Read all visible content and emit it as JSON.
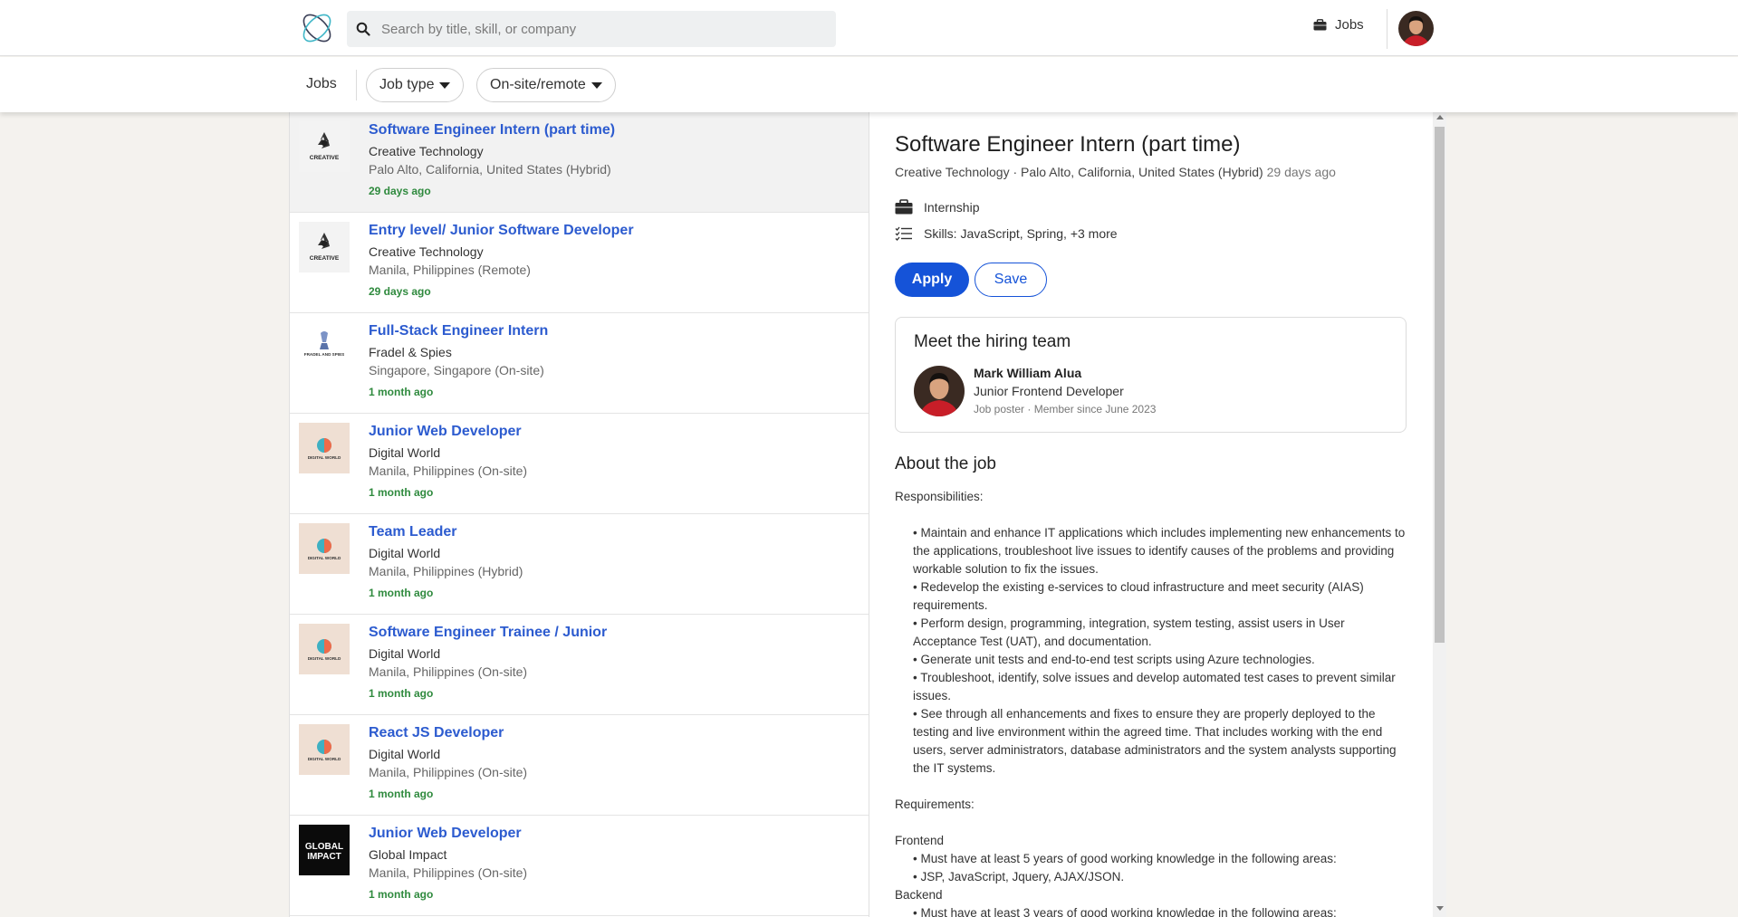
{
  "header": {
    "search_placeholder": "Search by title, skill, or company",
    "jobs_label": "Jobs"
  },
  "subbar": {
    "jobs_label": "Jobs",
    "filter_job_type": "Job type",
    "filter_location": "On-site/remote"
  },
  "jobs": [
    {
      "title": "Software Engineer Intern (part time)",
      "company": "Creative Technology",
      "location": "Palo Alto, California, United States (Hybrid)",
      "age": "29 days ago",
      "logo": "creative-logo"
    },
    {
      "title": "Entry level/ Junior Software Developer",
      "company": "Creative Technology",
      "location": "Manila, Philippines (Remote)",
      "age": "29 days ago",
      "logo": "creative-logo"
    },
    {
      "title": "Full-Stack Engineer Intern",
      "company": "Fradel & Spies",
      "location": "Singapore, Singapore (On-site)",
      "age": "1 month ago",
      "logo": "fradel-logo"
    },
    {
      "title": "Junior Web Developer",
      "company": "Digital World",
      "location": "Manila, Philippines (On-site)",
      "age": "1 month ago",
      "logo": "digital-world-logo"
    },
    {
      "title": "Team Leader",
      "company": "Digital World",
      "location": "Manila, Philippines (Hybrid)",
      "age": "1 month ago",
      "logo": "digital-world-logo"
    },
    {
      "title": "Software Engineer Trainee / Junior",
      "company": "Digital World",
      "location": "Manila, Philippines (On-site)",
      "age": "1 month ago",
      "logo": "digital-world-logo"
    },
    {
      "title": "React JS Developer",
      "company": "Digital World",
      "location": "Manila, Philippines (On-site)",
      "age": "1 month ago",
      "logo": "digital-world-logo"
    },
    {
      "title": "Junior Web Developer",
      "company": "Global Impact",
      "location": "Manila, Philippines (On-site)",
      "age": "1 month ago",
      "logo": "global-impact-logo"
    }
  ],
  "logo_text": {
    "creative": "CREATIVE",
    "fradel": "FRADEL AND SPIES",
    "digital": "DIGITAL WORLD",
    "global_1": "GLOBAL",
    "global_2": "IMPACT"
  },
  "detail": {
    "title": "Software Engineer Intern (part time)",
    "meta": "Creative Technology · Palo Alto, California, United States (Hybrid)",
    "posted": "29 days ago",
    "type": "Internship",
    "skills": "Skills: JavaScript, Spring, +3 more",
    "apply_label": "Apply",
    "save_label": "Save",
    "team": {
      "heading": "Meet the hiring team",
      "name": "Mark William Alua",
      "role": "Junior Frontend Developer",
      "meta": "Job poster · Member since June 2023"
    },
    "about_heading": "About the job",
    "responsibilities_label": "Responsibilities:",
    "responsibilities": [
      "• Maintain and enhance IT applications which includes implementing new enhancements to the applications, troubleshoot live issues to identify causes of the problems and providing workable solution to fix the issues.",
      "• Redevelop the existing e-services to cloud infrastructure and meet security (AIAS) requirements.",
      "• Perform design, programming, integration, system testing, assist users in User Acceptance Test (UAT), and documentation.",
      "• Generate unit tests and end-to-end test scripts using Azure technologies.",
      "• Troubleshoot, identify, solve issues and develop automated test cases to prevent similar issues.",
      "• See through all enhancements and fixes to ensure they are properly deployed to the testing and live environment within the agreed time. That includes working with the end users, server administrators, database administrators and the system analysts supporting the IT systems."
    ],
    "requirements_label": "Requirements:",
    "frontend_label": "Frontend",
    "frontend_items": [
      "• Must have at least 5 years of good working knowledge in the following areas:",
      "• JSP, JavaScript, Jquery, AJAX/JSON."
    ],
    "backend_label": "Backend",
    "backend_items": [
      "• Must have at least 3 years of good working knowledge in the following areas:"
    ]
  },
  "colors": {
    "accent": "#1553d8",
    "title_link": "#2c5bcf",
    "age_green": "#2f8a3e"
  }
}
